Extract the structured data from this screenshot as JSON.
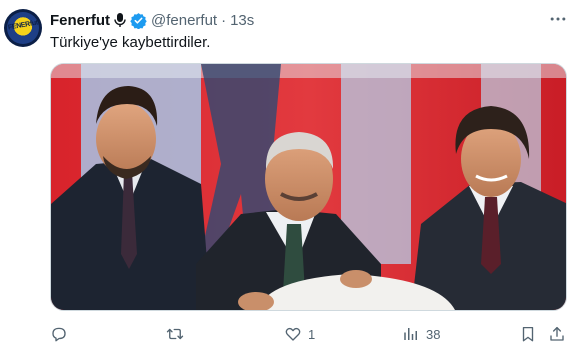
{
  "tweet": {
    "display_name": "Fenerfut",
    "handle": "@fenerfut",
    "separator": "·",
    "time": "13s",
    "text": "Türkiye'ye kaybettirdiler.",
    "avatar_text": "FENERfut"
  },
  "actions": {
    "reply_count": "",
    "retweet_count": "",
    "like_count": "1",
    "views_count": "38"
  },
  "icons": {
    "mic": "microphone-icon",
    "verified": "verified-badge-icon",
    "more": "more-dots-icon",
    "reply": "reply-icon",
    "retweet": "retweet-icon",
    "like": "heart-icon",
    "views": "views-chart-icon",
    "bookmark": "bookmark-icon",
    "share": "share-icon"
  },
  "colors": {
    "text": "#0f1419",
    "secondary": "#536471",
    "verified_blue": "#1d9bf0"
  }
}
